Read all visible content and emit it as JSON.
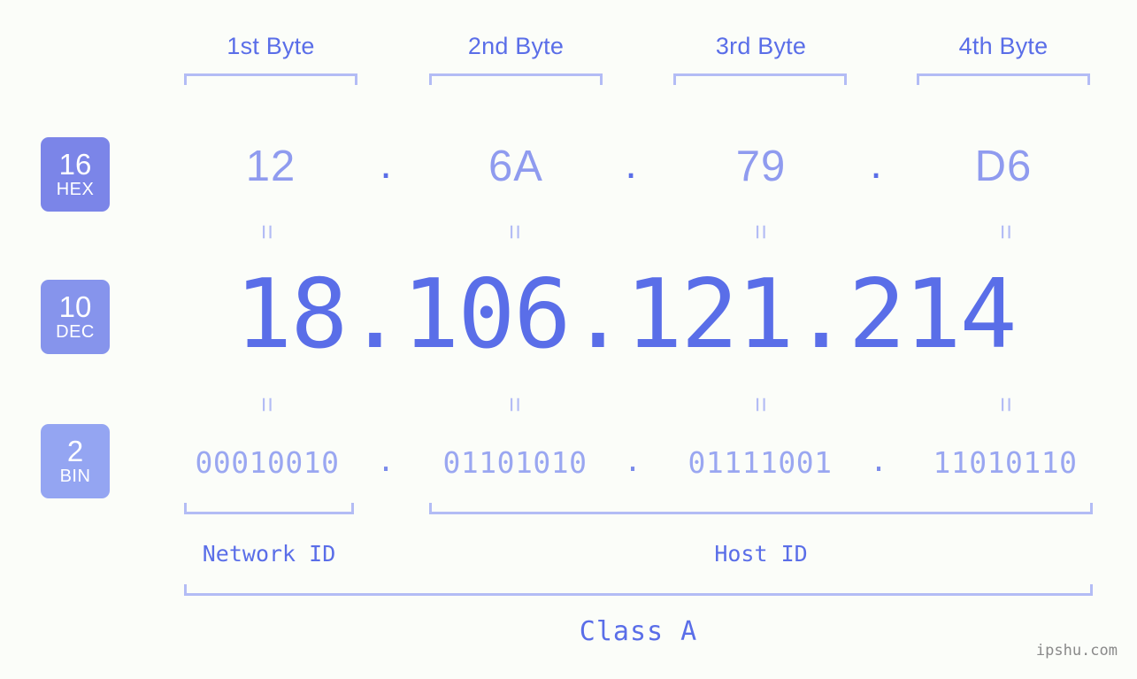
{
  "meta": {
    "background_color": "#fbfdf9",
    "accent_color": "#5a6ee8",
    "accent_light": "#b3bcf5",
    "watermark": "ipshu.com"
  },
  "byte_headers": [
    {
      "label": "1st Byte"
    },
    {
      "label": "2nd Byte"
    },
    {
      "label": "3rd Byte"
    },
    {
      "label": "4th Byte"
    }
  ],
  "radix_badges": [
    {
      "number": "16",
      "name": "HEX",
      "color": "#7b85e8"
    },
    {
      "number": "10",
      "name": "DEC",
      "color": "#8694ec"
    },
    {
      "number": "2",
      "name": "BIN",
      "color": "#94a5f2"
    }
  ],
  "rows": {
    "hex": {
      "radix": "16",
      "radix_name": "HEX",
      "octets": [
        "12",
        "6A",
        "79",
        "D6"
      ],
      "separator": "."
    },
    "dec": {
      "radix": "10",
      "radix_name": "DEC",
      "octets": [
        "18",
        "106",
        "121",
        "214"
      ],
      "separator": ".",
      "full": "18.106.121.214"
    },
    "bin": {
      "radix": "2",
      "radix_name": "BIN",
      "octets": [
        "00010010",
        "01101010",
        "01111001",
        "11010110"
      ],
      "separator": "."
    }
  },
  "equality_marks": {
    "glyph": "=",
    "count_per_row": 4
  },
  "segments": {
    "network_id": {
      "label": "Network ID",
      "bytes": 1
    },
    "host_id": {
      "label": "Host ID",
      "bytes": 3
    },
    "class": {
      "label": "Class A",
      "bytes": 4
    }
  }
}
